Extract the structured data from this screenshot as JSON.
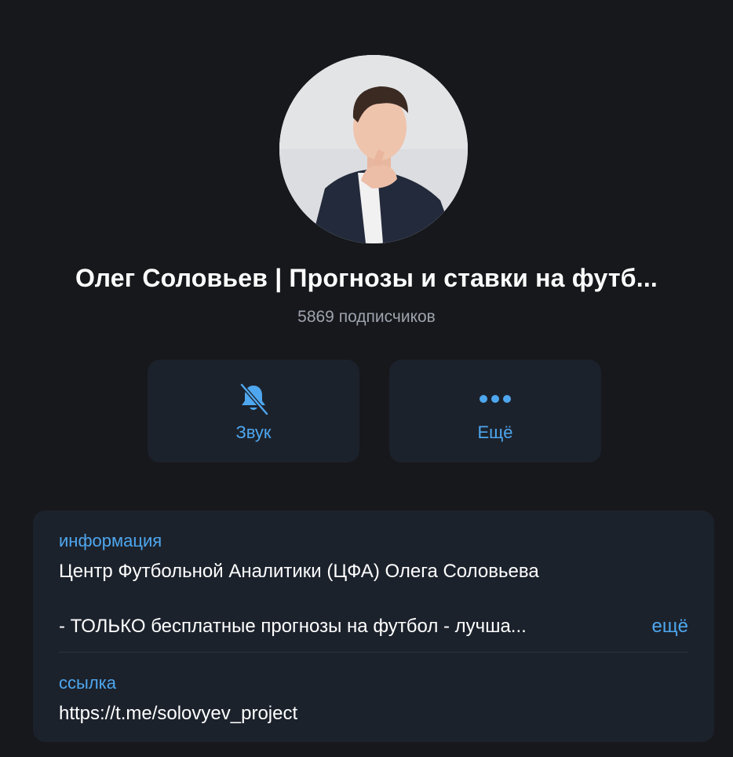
{
  "channel": {
    "name": "Олег Соловьев | Прогнозы и ставки на футб...",
    "subscribers": "5869 подписчиков"
  },
  "actions": {
    "sound_label": "Звук",
    "more_label": "Ещё"
  },
  "info": {
    "info_label": "информация",
    "description_line1": "Центр Футбольной Аналитики (ЦФА) Олега Соловьева",
    "description_line2": "- ТОЛЬКО бесплатные прогнозы на футбол - лучша...",
    "expand_label": "ещё",
    "link_label": "ссылка",
    "link_value": "https://t.me/solovyev_project"
  },
  "icons": {
    "sound": "bell-slash-icon",
    "more": "ellipsis-icon"
  },
  "colors": {
    "background": "#17181c",
    "card": "#1c222c",
    "accent": "#4ea7ef",
    "secondary_text": "#9ea3ad"
  }
}
